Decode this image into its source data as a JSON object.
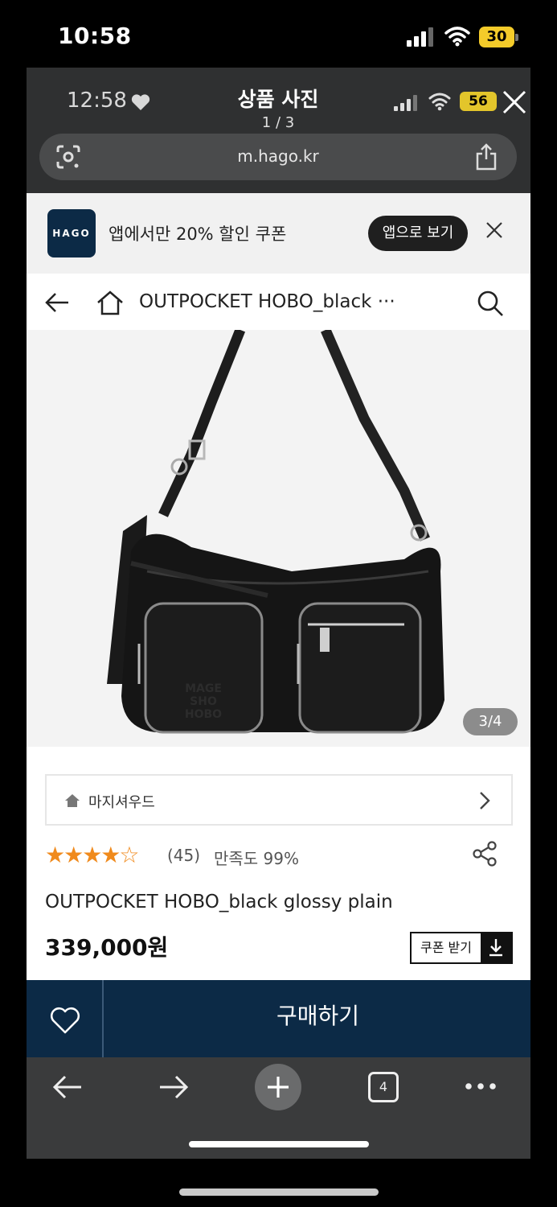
{
  "outer_status": {
    "time": "10:58",
    "battery": "30"
  },
  "inner_header": {
    "time": "12:58",
    "title": "상품 사진",
    "subtitle": "1 / 3",
    "battery": "56",
    "url": "m.hago.kr"
  },
  "app_banner": {
    "logo": "HAGO",
    "text": "앱에서만 20% 할인 쿠폰",
    "open_app": "앱으로 보기"
  },
  "nav": {
    "title": "OUTPOCKET HOBO_black ···"
  },
  "product": {
    "image_counter": "3/4",
    "bag_text": [
      "MAGE",
      "SHO",
      "HOBO"
    ],
    "store_name": "마지셔우드",
    "rating": 4,
    "rating_max": 5,
    "stars": "★★★★☆",
    "review_count": "(45)",
    "satisfaction": "만족도 99%",
    "name": "OUTPOCKET HOBO_black glossy plain",
    "price": "339,000원",
    "coupon": "쿠폰 받기"
  },
  "buy_bar": {
    "buy": "구매하기"
  },
  "browser_bar": {
    "tab_count": "4"
  },
  "colors": {
    "navy": "#0c2a46",
    "star": "#f08a1c",
    "dark_header": "#2f3031",
    "battery_yellow": "#f4cb2a"
  }
}
